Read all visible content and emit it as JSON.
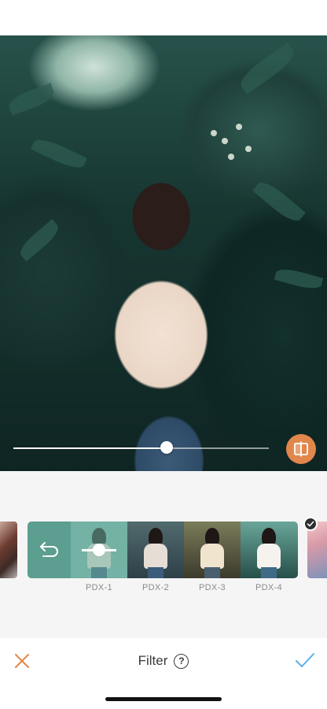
{
  "editor": {
    "photo": {
      "icon": "photo-preview",
      "subject": "portrait-photo"
    },
    "intensity": {
      "value": 0.6
    },
    "compare_icon": "compare-split-icon"
  },
  "filters": {
    "pack_back_icon": "undo-arrow-icon",
    "items": [
      {
        "label": "PDX-1"
      },
      {
        "label": "PDX-2"
      },
      {
        "label": "PDX-3"
      },
      {
        "label": "PDX-4"
      }
    ],
    "selected_indicator_icon": "check-icon"
  },
  "bottom_bar": {
    "title": "Filter",
    "help_label": "?",
    "cancel_icon": "close-icon",
    "confirm_icon": "checkmark-icon"
  },
  "colors": {
    "accent": "#e2874c",
    "confirm": "#5aaee6",
    "filter_pack": "#5c9e8f"
  }
}
